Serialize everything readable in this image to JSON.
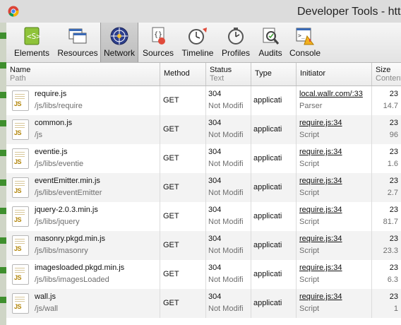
{
  "window": {
    "title": "Developer Tools - http"
  },
  "toolbar": {
    "items": [
      {
        "label": "Elements",
        "icon": "elements-icon"
      },
      {
        "label": "Resources",
        "icon": "resources-icon"
      },
      {
        "label": "Network",
        "icon": "network-icon",
        "active": true
      },
      {
        "label": "Sources",
        "icon": "sources-icon"
      },
      {
        "label": "Timeline",
        "icon": "timeline-icon"
      },
      {
        "label": "Profiles",
        "icon": "profiles-icon"
      },
      {
        "label": "Audits",
        "icon": "audits-icon"
      },
      {
        "label": "Console",
        "icon": "console-icon"
      }
    ]
  },
  "table": {
    "headers": {
      "name": "Name",
      "name_sub": "Path",
      "method": "Method",
      "status": "Status",
      "status_sub": "Text",
      "type": "Type",
      "initiator": "Initiator",
      "size": "Size",
      "size_sub": "Content"
    },
    "rows": [
      {
        "name": "require.js",
        "path": "/js/libs/require",
        "method": "GET",
        "status": "304",
        "status_text": "Not Modifi",
        "type": "applicati",
        "initiator": "local.wallr.com/:33",
        "initiator_type": "Parser",
        "size": "23",
        "content": "14.7"
      },
      {
        "name": "common.js",
        "path": "/js",
        "method": "GET",
        "status": "304",
        "status_text": "Not Modifi",
        "type": "applicati",
        "initiator": "require.js:34",
        "initiator_type": "Script",
        "size": "23",
        "content": "96"
      },
      {
        "name": "eventie.js",
        "path": "/js/libs/eventie",
        "method": "GET",
        "status": "304",
        "status_text": "Not Modifi",
        "type": "applicati",
        "initiator": "require.js:34",
        "initiator_type": "Script",
        "size": "23",
        "content": "1.6"
      },
      {
        "name": "eventEmitter.min.js",
        "path": "/js/libs/eventEmitter",
        "method": "GET",
        "status": "304",
        "status_text": "Not Modifi",
        "type": "applicati",
        "initiator": "require.js:34",
        "initiator_type": "Script",
        "size": "23",
        "content": "2.7"
      },
      {
        "name": "jquery-2.0.3.min.js",
        "path": "/js/libs/jquery",
        "method": "GET",
        "status": "304",
        "status_text": "Not Modifi",
        "type": "applicati",
        "initiator": "require.js:34",
        "initiator_type": "Script",
        "size": "23",
        "content": "81.7"
      },
      {
        "name": "masonry.pkgd.min.js",
        "path": "/js/libs/masonry",
        "method": "GET",
        "status": "304",
        "status_text": "Not Modifi",
        "type": "applicati",
        "initiator": "require.js:34",
        "initiator_type": "Script",
        "size": "23",
        "content": "23.3"
      },
      {
        "name": "imagesloaded.pkgd.min.js",
        "path": "/js/libs/imagesLoaded",
        "method": "GET",
        "status": "304",
        "status_text": "Not Modifi",
        "type": "applicati",
        "initiator": "require.js:34",
        "initiator_type": "Script",
        "size": "23",
        "content": "6.3"
      },
      {
        "name": "wall.js",
        "path": "/js/wall",
        "method": "GET",
        "status": "304",
        "status_text": "Not Modifi",
        "type": "applicati",
        "initiator": "require.js:34",
        "initiator_type": "Script",
        "size": "23",
        "content": "1"
      }
    ]
  }
}
